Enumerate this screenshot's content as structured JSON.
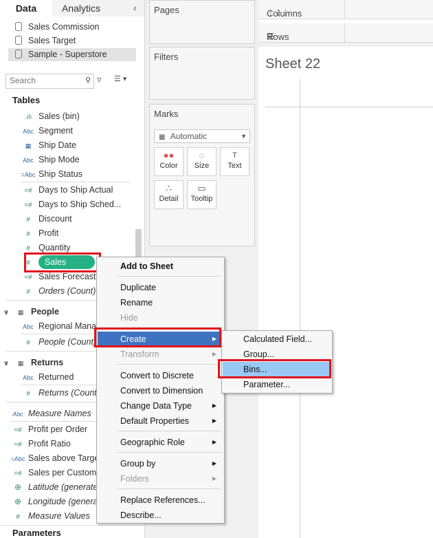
{
  "tabs": {
    "data": "Data",
    "analytics": "Analytics",
    "collapse": "‹"
  },
  "datasources": [
    "Sales Commission",
    "Sales Target",
    "Sample - Superstore"
  ],
  "search": {
    "placeholder": "Search",
    "icon": "search-icon"
  },
  "tables_heading": "Tables",
  "fields": [
    {
      "icon": ".ılı",
      "label": "Sales (bin)"
    },
    {
      "icon": "Abc",
      "label": "Segment"
    },
    {
      "icon": "▦",
      "label": "Ship Date"
    },
    {
      "icon": "Abc",
      "label": "Ship Mode"
    },
    {
      "icon": "=Abc",
      "label": "Ship Status"
    },
    {
      "icon": "=#",
      "label": "Days to Ship Actual"
    },
    {
      "icon": "=#",
      "label": "Days to Ship Sched..."
    },
    {
      "icon": "#",
      "label": "Discount"
    },
    {
      "icon": "#",
      "label": "Profit"
    },
    {
      "icon": "#",
      "label": "Quantity"
    },
    {
      "icon": "#",
      "label": "Sales"
    },
    {
      "icon": "=#",
      "label": "Sales Forecast"
    },
    {
      "icon": "#",
      "label": "Orders (Count)"
    }
  ],
  "people": {
    "heading": "People",
    "fields": [
      {
        "icon": "Abc",
        "label": "Regional Manager"
      },
      {
        "icon": "#",
        "label": "People (Count)"
      }
    ]
  },
  "returns": {
    "heading": "Returns",
    "fields": [
      {
        "icon": "Abc",
        "label": "Returned"
      },
      {
        "icon": "#",
        "label": "Returns (Count)"
      }
    ]
  },
  "extra_fields": [
    {
      "icon": "Abc",
      "label": "Measure Names"
    },
    {
      "icon": "=#",
      "label": "Profit per Order"
    },
    {
      "icon": "=#",
      "label": "Profit Ratio"
    },
    {
      "icon": "=Abc",
      "label": "Sales above Target?"
    },
    {
      "icon": "=#",
      "label": "Sales per Customer"
    },
    {
      "icon": "⊕",
      "label": "Latitude (generated)"
    },
    {
      "icon": "⊕",
      "label": "Longitude (generated)"
    },
    {
      "icon": "#",
      "label": "Measure Values"
    }
  ],
  "parameters_heading": "Parameters",
  "pages": "Pages",
  "filters": "Filters",
  "marks": {
    "title": "Marks",
    "type": "Automatic",
    "buttons": [
      {
        "label": "Color",
        "icon": "●●"
      },
      {
        "label": "Size",
        "icon": "◌"
      },
      {
        "label": "Text",
        "icon": "T"
      },
      {
        "label": "Detail",
        "icon": "∴"
      },
      {
        "label": "Tooltip",
        "icon": "▭"
      }
    ]
  },
  "columns": "Columns",
  "rows": "Rows",
  "sheet_title": "Sheet 22",
  "context_menu": {
    "items": [
      "Add to Sheet",
      "Duplicate",
      "Rename",
      "Hide",
      "Create",
      "Transform",
      "Convert to Discrete",
      "Convert to Dimension",
      "Change Data Type",
      "Default Properties",
      "Geographic Role",
      "Group by",
      "Folders",
      "Replace References...",
      "Describe..."
    ]
  },
  "create_submenu": {
    "items": [
      "Calculated Field...",
      "Group...",
      "Bins...",
      "Parameter..."
    ]
  }
}
